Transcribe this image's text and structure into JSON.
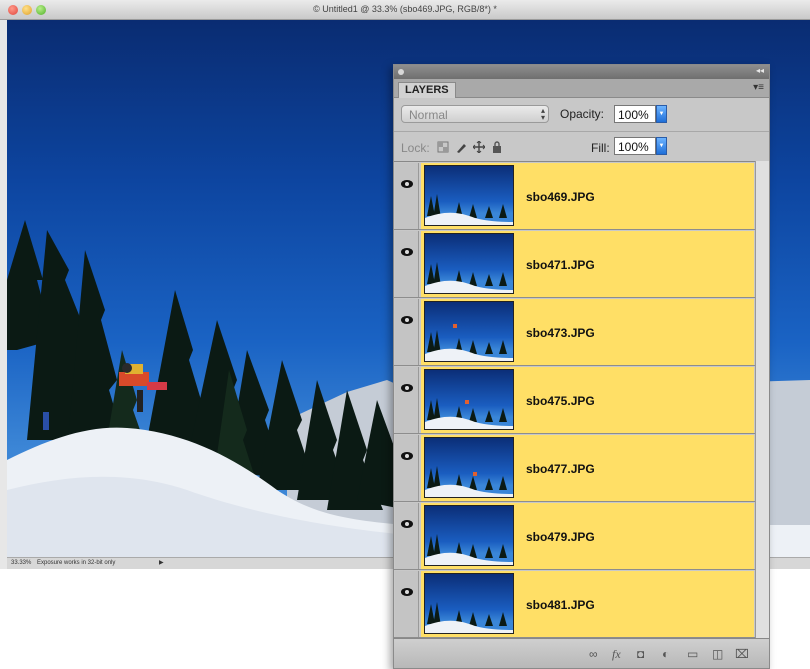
{
  "document": {
    "title": "© Untitled1 @ 33.3% (sbo469.JPG, RGB/8*) *",
    "zoom": "33.33%",
    "status_message": "Exposure works in 32-bit only",
    "status_arrow": "▶"
  },
  "layers_panel": {
    "tab_label": "LAYERS",
    "collapse_glyph": "◂◂",
    "menu_glyph": "▾≡",
    "blend_mode": "Normal",
    "blend_arrow": "▴▾",
    "opacity_label": "Opacity:",
    "opacity_value": "100%",
    "lock_label": "Lock:",
    "fill_label": "Fill:",
    "fill_value": "100%",
    "layers": [
      {
        "name": "sbo469.JPG",
        "visible": true,
        "selected": true
      },
      {
        "name": "sbo471.JPG",
        "visible": true,
        "selected": true
      },
      {
        "name": "sbo473.JPG",
        "visible": true,
        "selected": true
      },
      {
        "name": "sbo475.JPG",
        "visible": true,
        "selected": true
      },
      {
        "name": "sbo477.JPG",
        "visible": true,
        "selected": true
      },
      {
        "name": "sbo479.JPG",
        "visible": true,
        "selected": true
      },
      {
        "name": "sbo481.JPG",
        "visible": true,
        "selected": true
      }
    ],
    "footer_icons": [
      "link-icon",
      "fx-icon",
      "mask-icon",
      "adjustment-icon",
      "group-icon",
      "new-layer-icon",
      "trash-icon"
    ],
    "selection_color": "#ffdf66"
  }
}
